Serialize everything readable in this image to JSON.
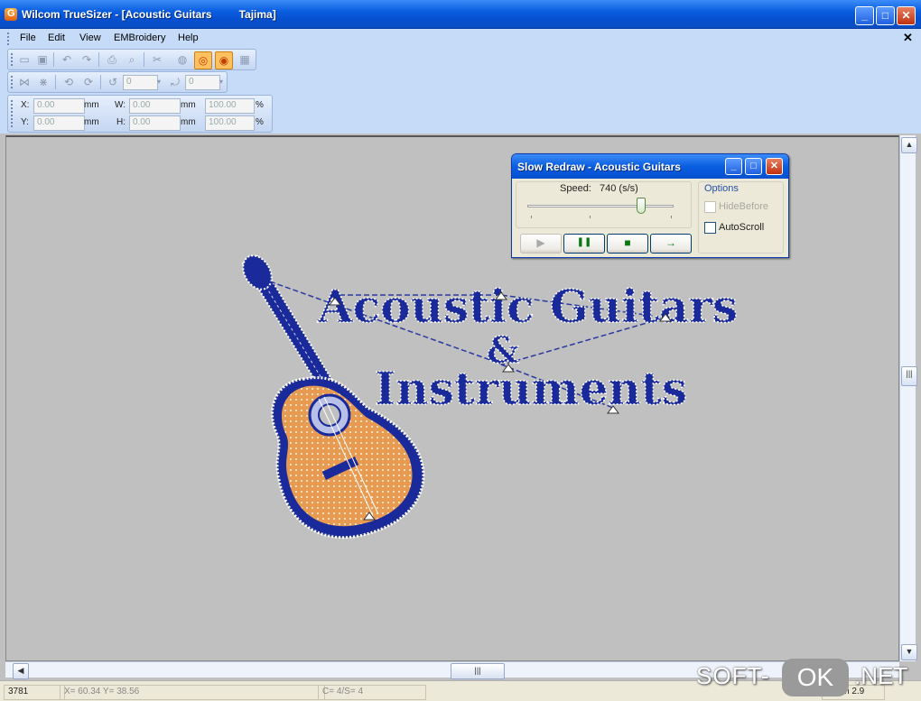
{
  "window": {
    "title": "Wilcom TrueSizer - [Acoustic Guitars         Tajima]",
    "buttons": {
      "minimize": "_",
      "maximize": "□",
      "close": "✕"
    },
    "doc_close": "✕"
  },
  "menu": {
    "items": [
      "File",
      "Edit",
      "View",
      "EMBroidery",
      "Help"
    ]
  },
  "toolbar_rows": {
    "angle1": "0",
    "angle2": "0"
  },
  "position_bar": {
    "x_label": "X:",
    "x_value": "0.00",
    "x_unit": "mm",
    "y_label": "Y:",
    "y_value": "0.00",
    "y_unit": "mm",
    "w_label": "W:",
    "w_value": "0.00",
    "w_unit": "mm",
    "h_label": "H:",
    "h_value": "0.00",
    "h_unit": "mm",
    "wpct_value": "100.00",
    "wpct_unit": "%",
    "hpct_value": "100.00",
    "hpct_unit": "%"
  },
  "design": {
    "line1": "Acoustic Guitars",
    "line2": "&",
    "line3": "Instruments",
    "colors": {
      "fill": "#1a2a9a",
      "guitar": "#e89a50",
      "outline": "#ffffff"
    }
  },
  "dialog": {
    "title": "Slow Redraw - Acoustic Guitars",
    "speed_label": "Speed:",
    "speed_value": "740 (s/s)",
    "speed_fraction": 0.78,
    "options_label": "Options",
    "hide_before_label": "HideBefore",
    "hide_before_checked": false,
    "autoscroll_label": "AutoScroll",
    "autoscroll_checked": false,
    "buttons": {
      "play": "▶",
      "pause": "❚❚",
      "stop": "■",
      "step": "→"
    }
  },
  "scrollbars": {
    "grip": "|||"
  },
  "status": {
    "stitches": "3781",
    "coords": "X= 60.34 Y= 38.56",
    "color": "C= 4/S= 4",
    "zoom": "Zoom 2.9"
  },
  "watermark": {
    "soft": "SOFT-",
    "ok": "OK",
    "net": ".NET"
  }
}
